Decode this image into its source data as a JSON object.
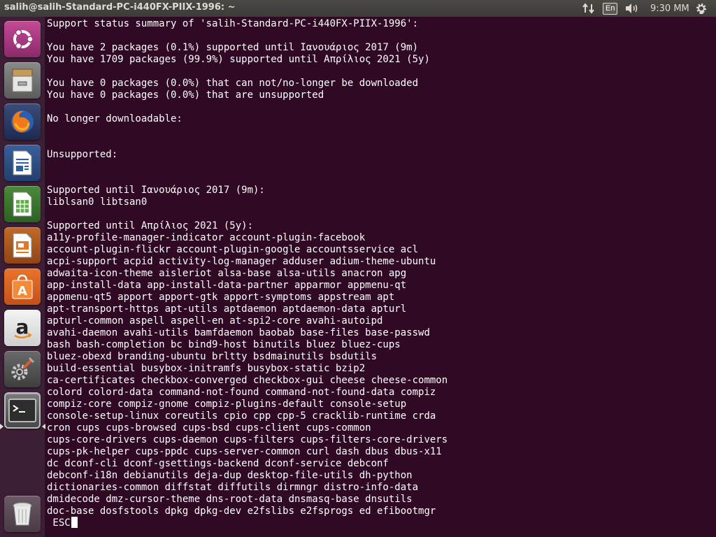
{
  "window": {
    "title": "salih@salih-Standard-PC-i440FX-PIIX-1996: ~"
  },
  "top_panel": {
    "keyboard_layout": "En",
    "clock": "9:30 MM",
    "icons": [
      "network-arrows-icon",
      "keyboard-layout-indicator",
      "volume-icon",
      "settings-gear-icon"
    ]
  },
  "launcher": {
    "items": [
      {
        "name": "ubuntu-dash",
        "icon": "ubuntu-logo-icon"
      },
      {
        "name": "files",
        "icon": "file-cabinet-icon"
      },
      {
        "name": "firefox",
        "icon": "firefox-icon"
      },
      {
        "name": "libreoffice-writer",
        "icon": "writer-document-icon"
      },
      {
        "name": "libreoffice-calc",
        "icon": "calc-spreadsheet-icon"
      },
      {
        "name": "libreoffice-impress",
        "icon": "impress-presentation-icon"
      },
      {
        "name": "ubuntu-software",
        "icon": "software-center-bag-icon"
      },
      {
        "name": "amazon",
        "icon": "amazon-icon"
      },
      {
        "name": "system-settings",
        "icon": "settings-tools-icon"
      },
      {
        "name": "terminal",
        "icon": "terminal-icon",
        "active": true
      },
      {
        "name": "trash",
        "icon": "trash-can-icon"
      }
    ]
  },
  "terminal": {
    "lines": [
      "Support status summary of 'salih-Standard-PC-i440FX-PIIX-1996':",
      "",
      "You have 2 packages (0.1%) supported until Ιανουάριος 2017 (9m)",
      "You have 1709 packages (99.9%) supported until Απρίλιος 2021 (5y)",
      "",
      "You have 0 packages (0.0%) that can not/no-longer be downloaded",
      "You have 0 packages (0.0%) that are unsupported",
      "",
      "No longer downloadable:",
      "",
      "",
      "Unsupported:",
      "",
      "",
      "Supported until Ιανουάριος 2017 (9m):",
      "liblsan0 libtsan0",
      "",
      "Supported until Απρίλιος 2021 (5y):",
      "a11y-profile-manager-indicator account-plugin-facebook",
      "account-plugin-flickr account-plugin-google accountsservice acl",
      "acpi-support acpid activity-log-manager adduser adium-theme-ubuntu",
      "adwaita-icon-theme aisleriot alsa-base alsa-utils anacron apg",
      "app-install-data app-install-data-partner apparmor appmenu-qt",
      "appmenu-qt5 apport apport-gtk apport-symptoms appstream apt",
      "apt-transport-https apt-utils aptdaemon aptdaemon-data apturl",
      "apturl-common aspell aspell-en at-spi2-core avahi-autoipd",
      "avahi-daemon avahi-utils bamfdaemon baobab base-files base-passwd",
      "bash bash-completion bc bind9-host binutils bluez bluez-cups",
      "bluez-obexd branding-ubuntu brltty bsdmainutils bsdutils",
      "build-essential busybox-initramfs busybox-static bzip2",
      "ca-certificates checkbox-converged checkbox-gui cheese cheese-common",
      "colord colord-data command-not-found command-not-found-data compiz",
      "compiz-core compiz-gnome compiz-plugins-default console-setup",
      "console-setup-linux coreutils cpio cpp cpp-5 cracklib-runtime crda",
      "cron cups cups-browsed cups-bsd cups-client cups-common",
      "cups-core-drivers cups-daemon cups-filters cups-filters-core-drivers",
      "cups-pk-helper cups-ppdc cups-server-common curl dash dbus dbus-x11",
      "dc dconf-cli dconf-gsettings-backend dconf-service debconf",
      "debconf-i18n debianutils deja-dup desktop-file-utils dh-python",
      "dictionaries-common diffstat diffutils dirmngr distro-info-data",
      "dmidecode dmz-cursor-theme dns-root-data dnsmasq-base dnsutils",
      "doc-base dosfstools dpkg dpkg-dev e2fslibs e2fsprogs ed efibootmgr"
    ],
    "prompt_line": " ESC"
  },
  "colors": {
    "terminal_bg": "#300a24",
    "terminal_fg": "#ffffff",
    "panel_bg": "#3c3b37",
    "launcher_bg": "#3c1f35"
  }
}
